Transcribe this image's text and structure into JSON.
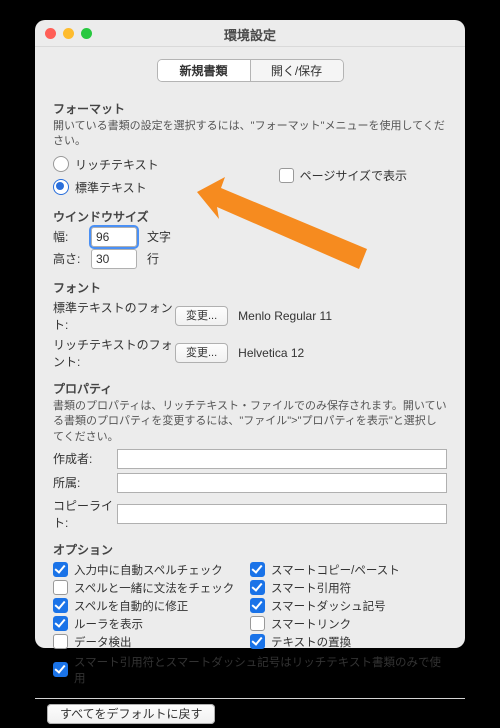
{
  "title": "環境設定",
  "tabs": {
    "new_doc": "新規書類",
    "open_save": "開く/保存"
  },
  "format": {
    "heading": "フォーマット",
    "desc": "開いている書類の設定を選択するには、\"フォーマット\"メニューを使用してください。",
    "rich": "リッチテキスト",
    "plain": "標準テキスト",
    "page_size": "ページサイズで表示"
  },
  "winsize": {
    "heading": "ウインドウサイズ",
    "width_label": "幅:",
    "width_value": "96",
    "width_unit": "文字",
    "height_label": "高さ:",
    "height_value": "30",
    "height_unit": "行"
  },
  "font": {
    "heading": "フォント",
    "plain_label": "標準テキストのフォント:",
    "rich_label": "リッチテキストのフォント:",
    "change_btn": "変更...",
    "plain_value": "Menlo Regular 11",
    "rich_value": "Helvetica 12"
  },
  "props": {
    "heading": "プロパティ",
    "desc": "書類のプロパティは、リッチテキスト・ファイルでのみ保存されます。開いている書類のプロパティを変更するには、\"ファイル\">\"プロパティを表示\"と選択してください。",
    "author": "作成者:",
    "org": "所属:",
    "copyright": "コピーライト:"
  },
  "options": {
    "heading": "オプション",
    "left": [
      {
        "label": "入力中に自動スペルチェック",
        "checked": true
      },
      {
        "label": "スペルと一緒に文法をチェック",
        "checked": false
      },
      {
        "label": "スペルを自動的に修正",
        "checked": true
      },
      {
        "label": "ルーラを表示",
        "checked": true
      },
      {
        "label": "データ検出",
        "checked": false
      }
    ],
    "right": [
      {
        "label": "スマートコピー/ペースト",
        "checked": true
      },
      {
        "label": "スマート引用符",
        "checked": true
      },
      {
        "label": "スマートダッシュ記号",
        "checked": true
      },
      {
        "label": "スマートリンク",
        "checked": false
      },
      {
        "label": "テキストの置換",
        "checked": true
      }
    ],
    "full": {
      "label": "スマート引用符とスマートダッシュ記号はリッチテキスト書類のみで使用",
      "checked": true
    }
  },
  "footer": {
    "reset": "すべてをデフォルトに戻す"
  }
}
